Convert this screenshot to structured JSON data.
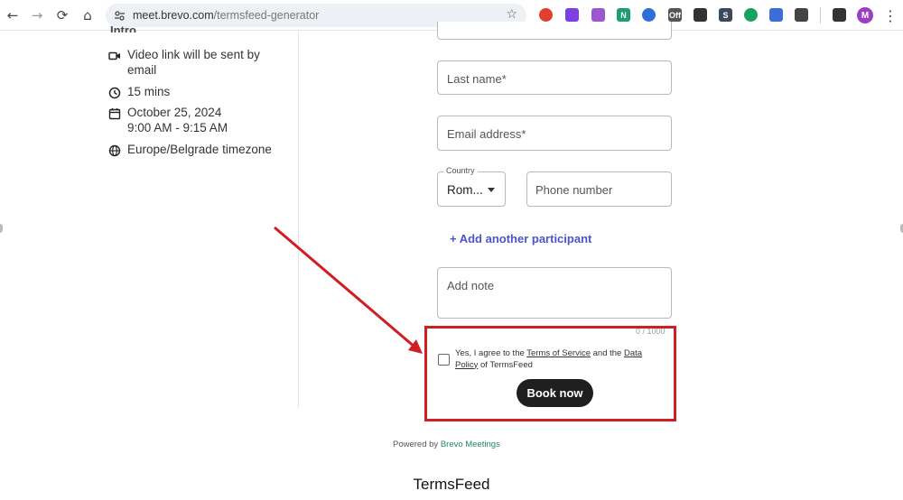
{
  "browser": {
    "url_host": "meet.brevo.com",
    "url_path": "/termsfeed-generator",
    "nav_back": "←",
    "nav_forward": "→",
    "nav_reload": "⟳",
    "nav_home": "⌂",
    "star": "☆",
    "menu": "⋮",
    "profile_initial": "M",
    "extensions": [
      {
        "name": "color-wheel-extension-icon",
        "label": "",
        "color": "#e0402f"
      },
      {
        "name": "purple-gear-extension-icon",
        "label": "",
        "color": "#7b3fe4"
      },
      {
        "name": "pen-extension-icon",
        "label": "",
        "color": "#9b59d0"
      },
      {
        "name": "n-extension-icon",
        "label": "N",
        "color": "#1f9e6e"
      },
      {
        "name": "blue-circle-extension-icon",
        "label": "",
        "color": "#2f6fd8"
      },
      {
        "name": "off-extension-icon",
        "label": "Off",
        "color": "#555555"
      },
      {
        "name": "arrow-extension-icon",
        "label": "",
        "color": "#333333"
      },
      {
        "name": "s-extension-icon",
        "label": "S",
        "color": "#3b4a5a"
      },
      {
        "name": "green-circle-extension-icon",
        "label": "",
        "color": "#16a35b"
      },
      {
        "name": "stack-extension-icon",
        "label": "",
        "color": "#3a6fd8"
      },
      {
        "name": "puzzle-extension-icon",
        "label": "",
        "color": "#444444"
      },
      {
        "name": "media-extension-icon",
        "label": "",
        "color": "#333333"
      }
    ]
  },
  "details": {
    "video": "Video link will be sent by email",
    "duration": "15 mins",
    "date": "October 25, 2024",
    "time": "9:00 AM - 9:15 AM",
    "timezone": "Europe/Belgrade timezone"
  },
  "form": {
    "last_name_placeholder": "Last name*",
    "email_placeholder": "Email address*",
    "country_label": "Country",
    "country_value": "Rom...",
    "phone_placeholder": "Phone number",
    "add_participant": "+ Add another participant",
    "note_placeholder": "Add note",
    "note_counter": "0 / 1000",
    "agree_prefix": "Yes, I agree to the ",
    "terms_link": "Terms of Service",
    "agree_middle": " and the ",
    "data_link": "Data Policy",
    "agree_suffix": " of TermsFeed",
    "book_button": "Book now"
  },
  "footer": {
    "powered_by": "Powered by ",
    "powered_brand": "Brevo Meetings",
    "caption": "TermsFeed"
  },
  "colors": {
    "highlight": "#d01f24",
    "link": "#4a55c9",
    "button": "#1f1f1f"
  }
}
